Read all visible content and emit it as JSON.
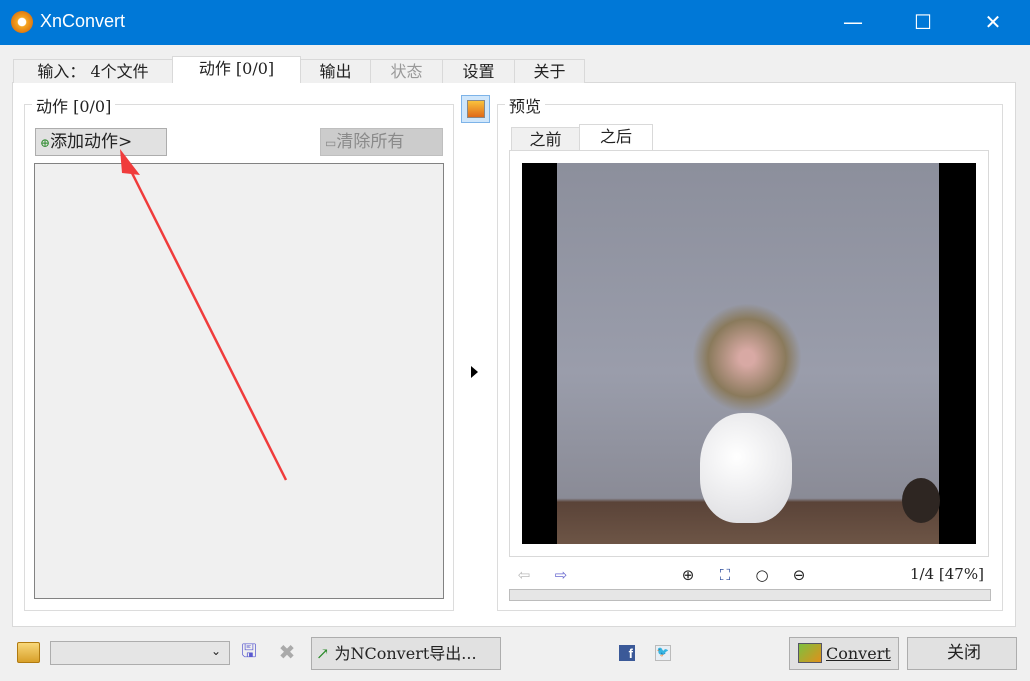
{
  "window": {
    "title": "XnConvert",
    "minimize": "—",
    "maximize": "☐",
    "close": "✕"
  },
  "tabs": [
    {
      "label": "输入： 4个文件"
    },
    {
      "label": "动作 [0/0]"
    },
    {
      "label": "输出"
    },
    {
      "label": "状态"
    },
    {
      "label": "设置"
    },
    {
      "label": "关于"
    }
  ],
  "actions": {
    "group_title": "动作 [0/0]",
    "add_label": "添加动作>",
    "clear_label": "清除所有"
  },
  "preview": {
    "group_title": "预览",
    "tabs": [
      {
        "label": "之前"
      },
      {
        "label": "之后"
      }
    ],
    "page_info": "1/4 [47%]",
    "progress": 0
  },
  "bottom": {
    "preset_value": "",
    "export_label": "为NConvert导出...",
    "convert_label": "Convert",
    "close_label": "关闭"
  },
  "colors": {
    "titlebar": "#0078d7",
    "annotation_arrow": "#f03c3c"
  }
}
